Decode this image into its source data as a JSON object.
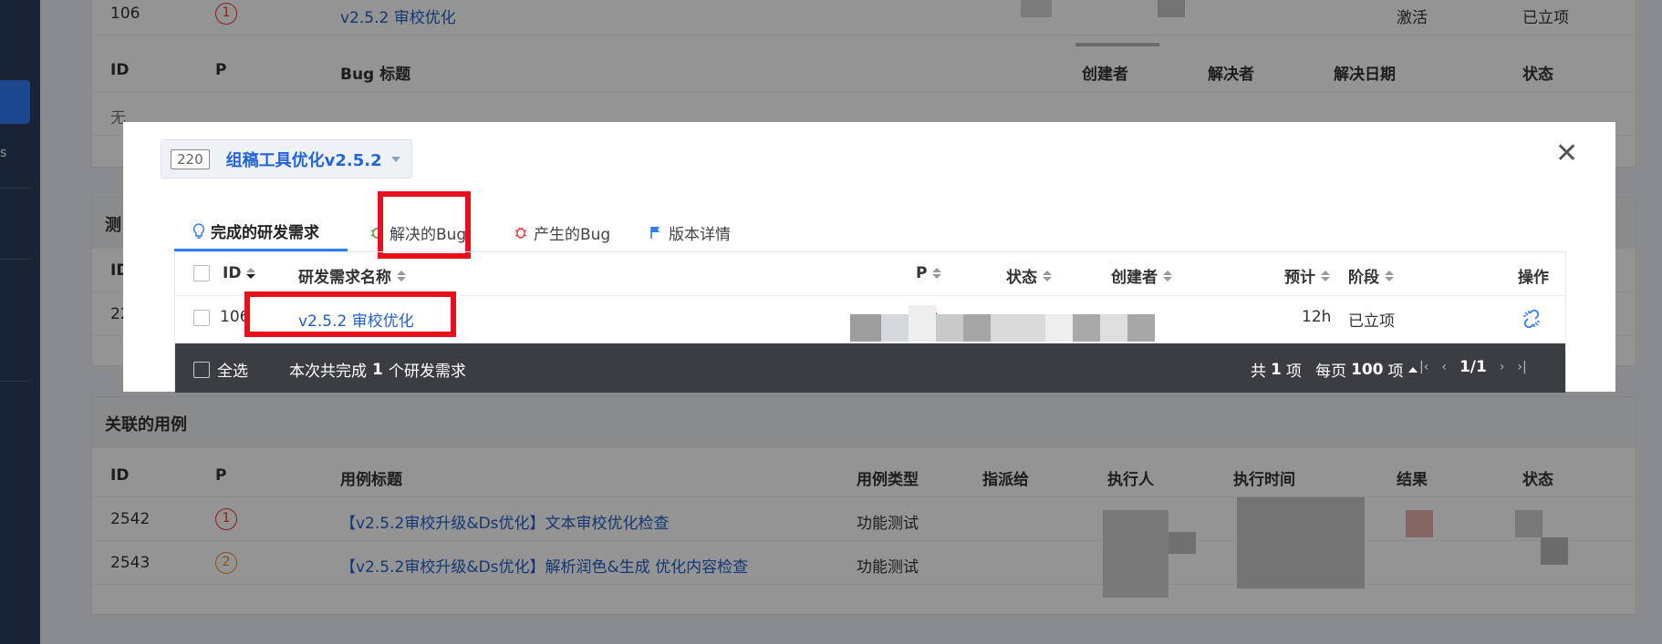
{
  "bg": {
    "row_top": {
      "id": "106",
      "priority": "1",
      "title": "v2.5.2 审校优化",
      "status": "激活",
      "stage": "已立项"
    },
    "bug_head": {
      "id": "ID",
      "p": "P",
      "title": "Bug 标题",
      "creator": "创建者",
      "resolver": "解决者",
      "date": "解决日期",
      "status": "状态"
    },
    "bug_empty": "无",
    "test_section_fragment": "测",
    "test_head_fragment": "ID",
    "test_row_fragment": "22",
    "cases_title": "关联的用例",
    "cases_head": {
      "id": "ID",
      "p": "P",
      "title": "用例标题",
      "type": "用例类型",
      "assignee": "指派给",
      "executor": "执行人",
      "time": "执行时间",
      "result": "结果",
      "status": "状态"
    },
    "cases": [
      {
        "id": "2542",
        "priority": "1",
        "title": "【v2.5.2审校升级&Ds优化】文本审校优化检查",
        "type": "功能测试"
      },
      {
        "id": "2543",
        "priority": "2",
        "title": "【v2.5.2审校升级&Ds优化】解析润色&生成 优化内容检查",
        "type": "功能测试"
      }
    ],
    "sidebar_fragment": "s"
  },
  "modal": {
    "build_id": "220",
    "build_name": "组稿工具优化v2.5.2",
    "close_glyph": "✕",
    "tabs": [
      {
        "label": "完成的研发需求",
        "icon": "lightbulb-icon",
        "active": true
      },
      {
        "label": "解决的Bug",
        "icon": "bug-icon",
        "active": false
      },
      {
        "label": "产生的Bug",
        "icon": "bug-icon",
        "active": false
      },
      {
        "label": "版本详情",
        "icon": "flag-icon",
        "active": false
      }
    ],
    "table": {
      "columns": {
        "id": "ID",
        "name": "研发需求名称",
        "p": "P",
        "status": "状态",
        "creator": "创建者",
        "estimate": "预计",
        "stage": "阶段",
        "action": "操作"
      },
      "rows": [
        {
          "id": "106",
          "name": "v2.5.2 审校优化",
          "priority": "1",
          "estimate": "12h",
          "stage": "已立项"
        }
      ]
    },
    "footer": {
      "select_all": "全选",
      "summary_prefix": "本次共完成",
      "summary_count": "1",
      "summary_suffix": "个研发需求",
      "total_prefix": "共",
      "total_count": "1",
      "total_suffix": "项",
      "per_page_prefix": "每页",
      "per_page": "100",
      "per_page_suffix": "项",
      "page": "1/1"
    }
  },
  "colors": {
    "accent": "#2f7df6",
    "highlight_box": "#e8101b",
    "priority_red": "#e33",
    "priority_orange": "#e8902a"
  }
}
